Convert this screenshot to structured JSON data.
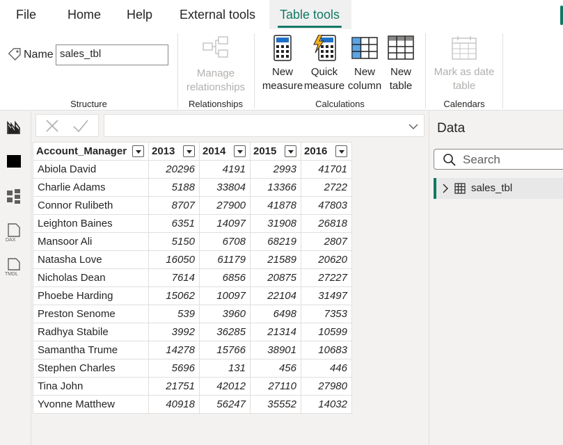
{
  "menu": {
    "tabs": [
      "File",
      "Home",
      "Help",
      "External tools",
      "Table tools"
    ],
    "active_tab": "Table tools"
  },
  "ribbon": {
    "structure": {
      "name_label": "Name",
      "name_value": "sales_tbl",
      "group_label": "Structure"
    },
    "relationships": {
      "manage_line1": "Manage",
      "manage_line2": "relationships",
      "group_label": "Relationships"
    },
    "calculations": {
      "new_measure_1": "New",
      "new_measure_2": "measure",
      "quick_measure_1": "Quick",
      "quick_measure_2": "measure",
      "new_column_1": "New",
      "new_column_2": "column",
      "new_table_1": "New",
      "new_table_2": "table",
      "group_label": "Calculations"
    },
    "calendars": {
      "mark_line1": "Mark as date",
      "mark_line2": "table",
      "group_label": "Calendars"
    }
  },
  "grid": {
    "columns": [
      "Account_Manager",
      "2013",
      "2014",
      "2015",
      "2016"
    ],
    "rows": [
      [
        "Abiola David",
        "20296",
        "4191",
        "2993",
        "41701"
      ],
      [
        "Charlie Adams",
        "5188",
        "33804",
        "13366",
        "2722"
      ],
      [
        "Connor Rulibeth",
        "8707",
        "27900",
        "41878",
        "47803"
      ],
      [
        "Leighton Baines",
        "6351",
        "14097",
        "31908",
        "26818"
      ],
      [
        "Mansoor Ali",
        "5150",
        "6708",
        "68219",
        "2807"
      ],
      [
        "Natasha Love",
        "16050",
        "61179",
        "21589",
        "20620"
      ],
      [
        "Nicholas Dean",
        "7614",
        "6856",
        "20875",
        "27227"
      ],
      [
        "Phoebe Harding",
        "15062",
        "10097",
        "22104",
        "31497"
      ],
      [
        "Preston Senome",
        "539",
        "3960",
        "6498",
        "7353"
      ],
      [
        "Radhya Stabile",
        "3992",
        "36285",
        "21314",
        "10599"
      ],
      [
        "Samantha Trume",
        "14278",
        "15766",
        "38901",
        "10683"
      ],
      [
        "Stephen Charles",
        "5696",
        "131",
        "456",
        "446"
      ],
      [
        "Tina John",
        "21751",
        "42012",
        "27110",
        "27980"
      ],
      [
        "Yvonne Matthew",
        "40918",
        "56247",
        "35552",
        "14032"
      ]
    ]
  },
  "data_pane": {
    "title": "Data",
    "search_placeholder": "Search",
    "tables": [
      "sales_tbl"
    ]
  },
  "colors": {
    "accent": "#117865",
    "disabled": "#b3b0ad"
  }
}
